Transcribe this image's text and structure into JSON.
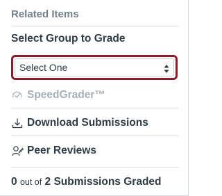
{
  "panel": {
    "title": "Related Items",
    "select_group_label": "Select Group to Grade",
    "select": {
      "value": "Select One"
    },
    "speedgrader_label": "SpeedGrader™",
    "download_label": "Download Submissions",
    "peer_reviews_label": "Peer Reviews",
    "graded": {
      "count": "0",
      "out_of": "out of",
      "rest": "2 Submissions Graded"
    }
  },
  "colors": {
    "focus_border": "#8b1c2c",
    "disabled_text": "#a5afb5",
    "text": "#2d3b45",
    "header_text": "#73818c"
  },
  "icons": {
    "select_arrows": "sort-arrows-icon",
    "speedgrader": "speedgrader-icon",
    "download": "download-icon",
    "peer_reviews": "peer-review-icon"
  }
}
